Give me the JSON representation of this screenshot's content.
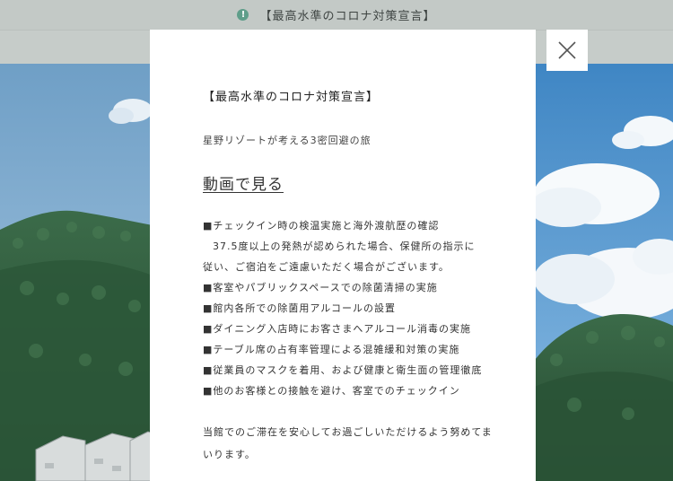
{
  "notice": {
    "icon": "alert-icon",
    "icon_glyph": "!",
    "text": "【最高水準のコロナ対策宣言】"
  },
  "modal": {
    "title": "【最高水準のコロナ対策宣言】",
    "subtitle": "星野リゾートが考える3密回避の旅",
    "video_link": "動画で見る",
    "measures": [
      "■チェックイン時の検温実施と海外渡航歴の確認",
      "37.5度以上の発熱が認められた場合、保健所の指示に",
      "従い、ご宿泊をご遠慮いただく場合がございます。",
      "■客室やパブリックスペースでの除菌清掃の実施",
      "■館内各所での除菌用アルコールの設置",
      "■ダイニング入店時にお客さまへアルコール消毒の実施",
      "■テーブル席の占有率管理による混雑緩和対策の実施",
      "■従業員のマスクを着用、および健康と衛生面の管理徹底",
      "■他のお客様との接触を避け、客室でのチェックイン"
    ],
    "closing": [
      "当館でのご滞在を安心してお過ごしいただけるよう努めてま",
      "いります。"
    ]
  },
  "close_button": {
    "icon": "close-icon"
  },
  "colors": {
    "notice_bg": "#c3c9c6",
    "notice_icon": "#5f9e8a",
    "accent_line": "#7a9c86",
    "modal_bg": "#ffffff",
    "text": "#333333",
    "sky": "#8fb8d8",
    "forest": "#2f5a3e"
  }
}
